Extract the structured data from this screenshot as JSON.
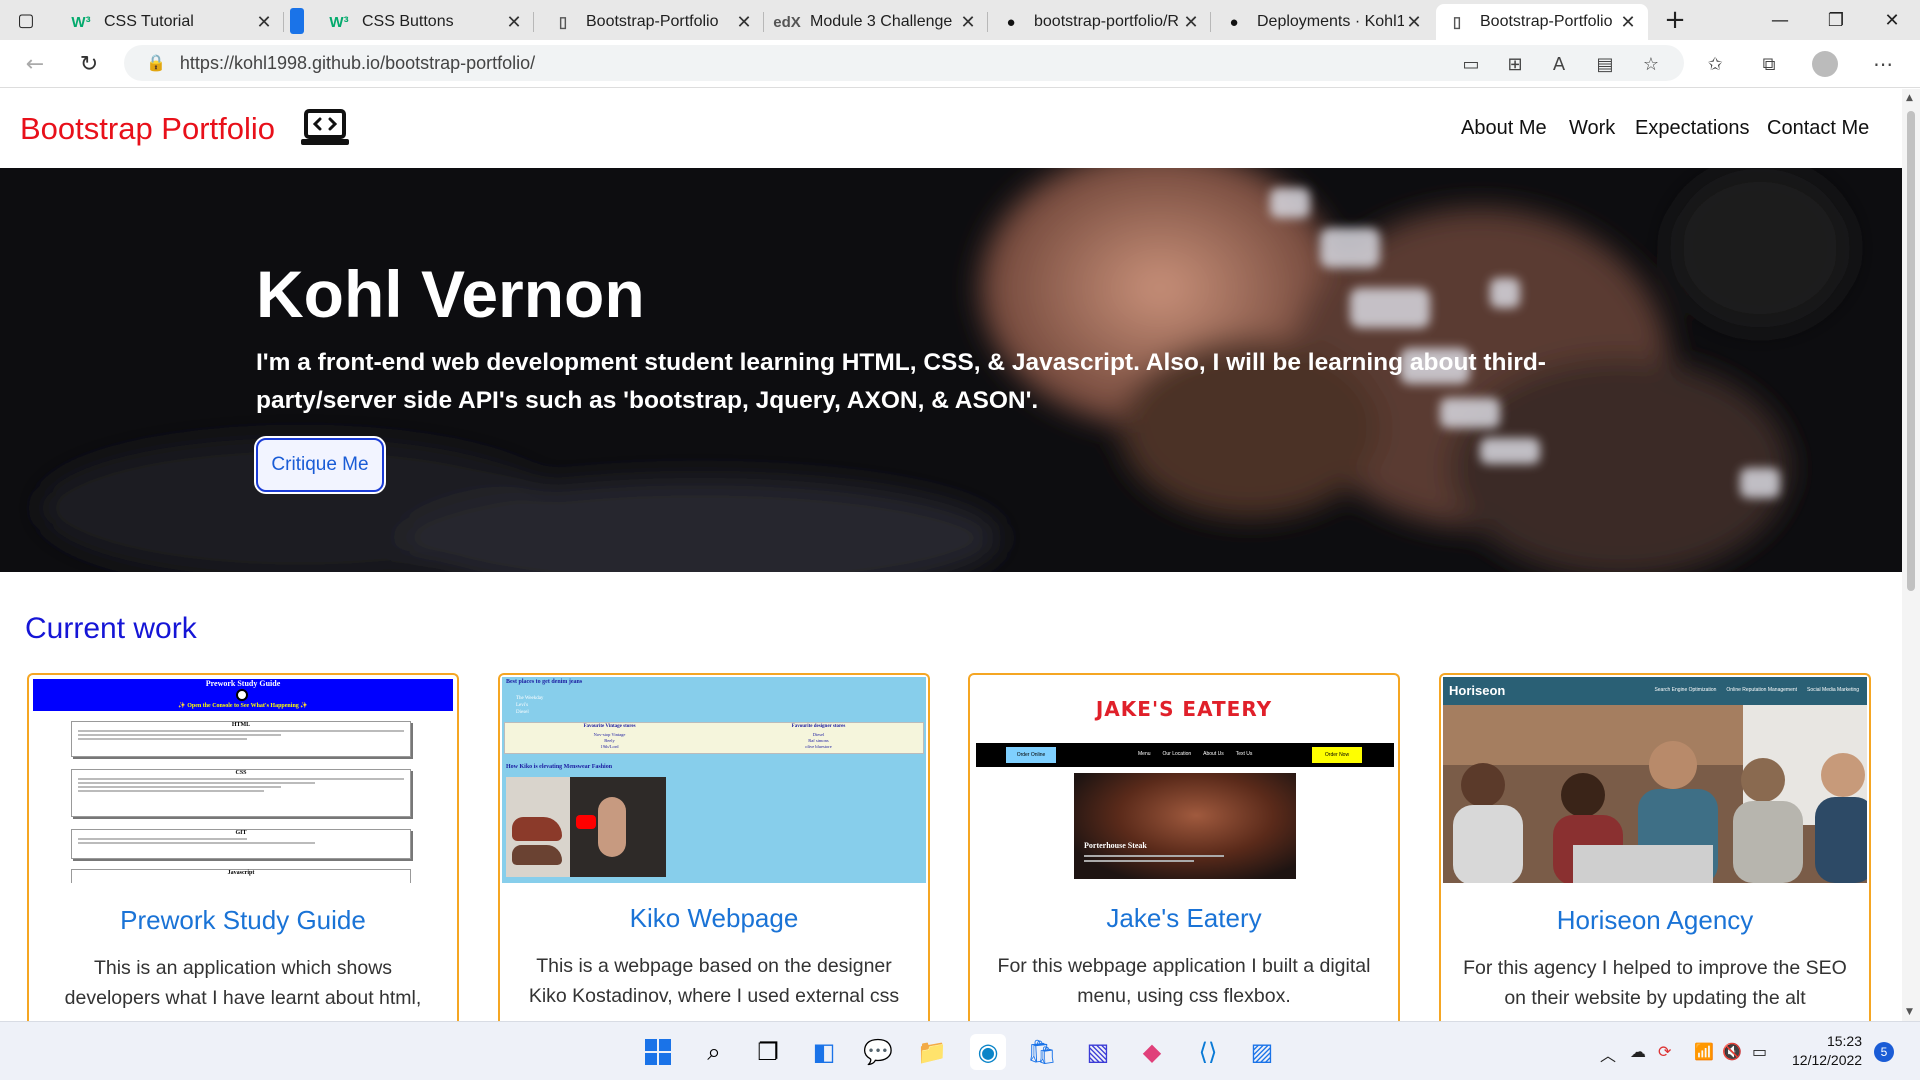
{
  "browser": {
    "tabs": [
      {
        "title": "CSS Tutorial",
        "favicon": "W³",
        "color": "#04aa6d"
      },
      {
        "title": "CSS Buttons",
        "favicon": "W³",
        "color": "#04aa6d"
      },
      {
        "title": "Bootstrap-Portfolio",
        "favicon": "page",
        "color": "#555"
      },
      {
        "title": "Module 3 Challenge",
        "favicon": "edX",
        "color": "#555"
      },
      {
        "title": "bootstrap-portfolio/R",
        "favicon": "github",
        "color": "#111"
      },
      {
        "title": "Deployments · Kohl1",
        "favicon": "github",
        "color": "#111"
      },
      {
        "title": "Bootstrap-Portfolio",
        "favicon": "page",
        "color": "#555"
      }
    ],
    "url": "https://kohl1998.github.io/bootstrap-portfolio/"
  },
  "site": {
    "brand": "Bootstrap Portfolio",
    "nav": [
      "About Me",
      "Work",
      "Expectations",
      "Contact Me"
    ],
    "hero": {
      "name": "Kohl Vernon",
      "text": "I'm a front-end web development student learning HTML, CSS, & Javascript. Also, I will be learning about third-party/server side API's such as 'bootstrap, Jquery, AXON, & ASON'.",
      "button": "Critique Me"
    },
    "section_title": "Current work",
    "cards": [
      {
        "title": "Prework Study Guide",
        "desc": "This is an application which shows developers what I have learnt about html,",
        "thumb": {
          "heading": "Prework Study Guide",
          "subheading": "✨ Open the Console to See What's Happening ✨",
          "sections": [
            "HTML",
            "CSS",
            "GIT",
            "Javascript"
          ]
        }
      },
      {
        "title": "Kiko Webpage",
        "desc": "This is a webpage based on the designer Kiko Kostadinov, where I used external css",
        "thumb": {
          "heading": "Best places to get denim jeans",
          "list": [
            "The Weekday",
            "Levi's",
            "Diesel"
          ],
          "col1": "Favourite Vintage stores",
          "col2": "Favourite designer stores",
          "rows1": [
            "Nov-stop Vintage",
            "Beely",
            "19th/Lord"
          ],
          "rows2": [
            "Diesel",
            "Raf simons",
            "olive bluestore"
          ],
          "video_title": "How Kiko is elevating Menswear Fashion"
        }
      },
      {
        "title": "Jake's Eatery",
        "desc": "For this webpage application I built a digital menu, using css flexbox.",
        "thumb": {
          "logo": "JAKE'S EATERY",
          "nav": [
            "Menu",
            "Our Location",
            "About Us",
            "Text Us"
          ],
          "btn_left": "Order Online",
          "btn_right": "Order Now",
          "dish": "Porterhouse Steak"
        }
      },
      {
        "title": "Horiseon Agency",
        "desc": "For this agency I helped to improve the SEO on their website by updating the alt",
        "thumb": {
          "brand": "Horiseon",
          "nav": [
            "Search Engine Optimization",
            "Online Reputation Management",
            "Social Media Marketing"
          ]
        }
      }
    ]
  },
  "taskbar": {
    "time": "15:23",
    "date": "12/12/2022",
    "notifications": "5"
  }
}
